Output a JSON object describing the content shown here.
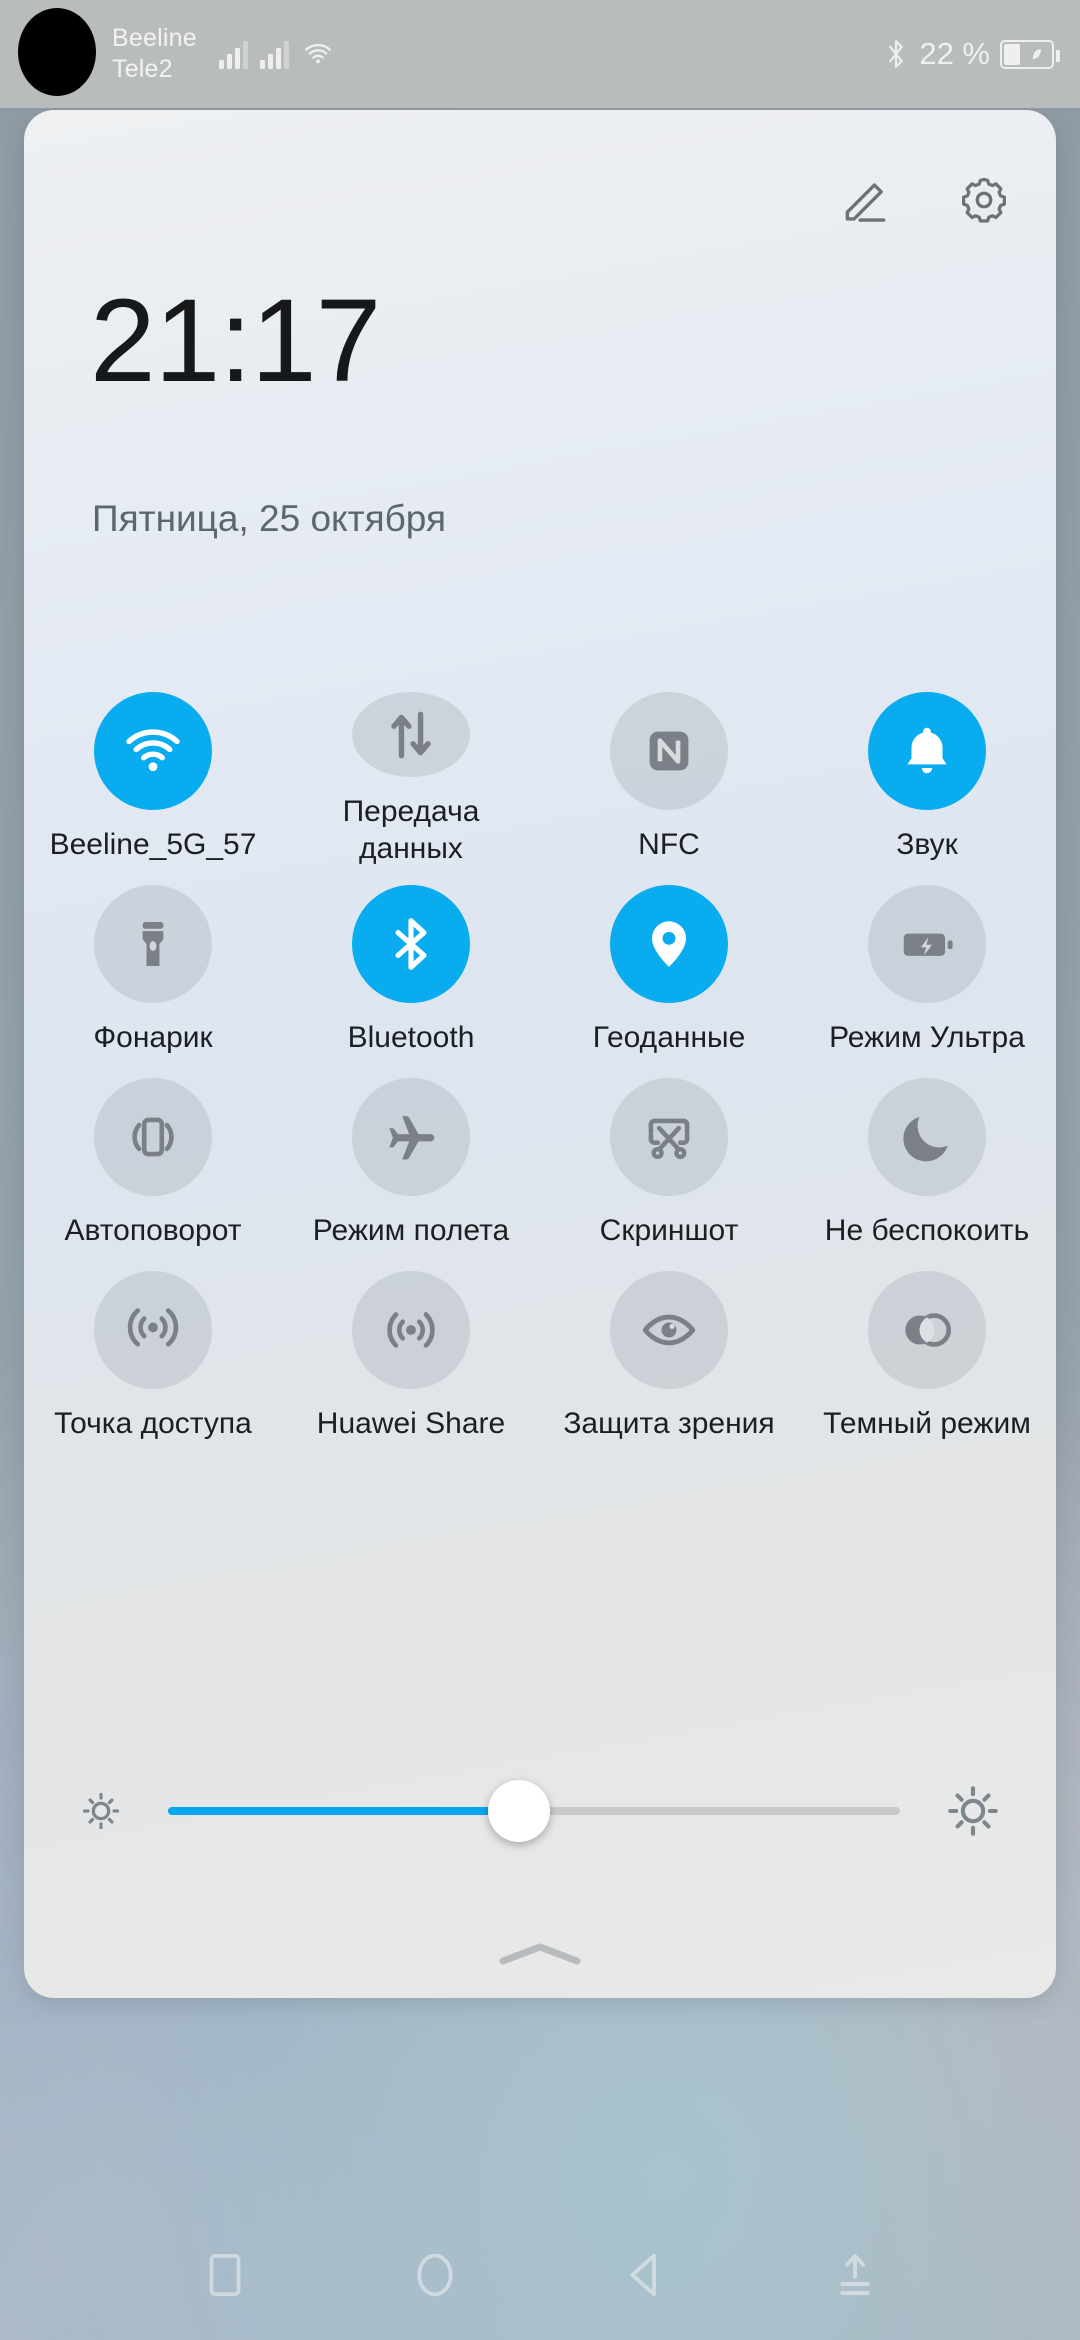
{
  "status_bar": {
    "carriers": [
      "Beeline",
      "Tele2"
    ],
    "icons": [
      "signal-bars-sim1-icon",
      "signal-bars-sim2-icon",
      "wifi-icon",
      "bluetooth-icon"
    ],
    "battery_percent": "22 %",
    "battery_icon": "battery-power-saving-leaf-icon",
    "camera_punch_hole": "front-camera-cutout"
  },
  "panel": {
    "header": {
      "edit_icon": "pencil-edit-icon",
      "settings_icon": "gear-settings-icon"
    },
    "clock": "21:17",
    "date": "Пятница, 25 октября",
    "tiles": [
      {
        "label": "Beeline_5G_57",
        "icon": "wifi-icon",
        "active": true
      },
      {
        "label": "Передача данных",
        "icon": "data-transfer-icon",
        "active": false
      },
      {
        "label": "NFC",
        "icon": "nfc-icon",
        "active": false
      },
      {
        "label": "Звук",
        "icon": "bell-sound-icon",
        "active": true
      },
      {
        "label": "Фонарик",
        "icon": "flashlight-icon",
        "active": false
      },
      {
        "label": "Bluetooth",
        "icon": "bluetooth-icon",
        "active": true
      },
      {
        "label": "Геоданные",
        "icon": "location-pin-icon",
        "active": true
      },
      {
        "label": "Режим Ультра",
        "icon": "battery-bolt-icon",
        "active": false
      },
      {
        "label": "Автоповорот",
        "icon": "auto-rotate-icon",
        "active": false
      },
      {
        "label": "Режим полета",
        "icon": "airplane-icon",
        "active": false
      },
      {
        "label": "Скриншот",
        "icon": "scissors-screenshot-icon",
        "active": false
      },
      {
        "label": "Не беспокоить",
        "icon": "moon-dnd-icon",
        "active": false
      },
      {
        "label": "Точка доступа",
        "icon": "hotspot-icon",
        "active": false
      },
      {
        "label": "Huawei Share",
        "icon": "huawei-share-icon",
        "active": false
      },
      {
        "label": "Защита зрения",
        "icon": "eye-comfort-icon",
        "active": false
      },
      {
        "label": "Темный режим",
        "icon": "dark-mode-circles-icon",
        "active": false
      }
    ],
    "brightness": {
      "low_icon": "sun-small-icon",
      "high_icon": "sun-large-icon",
      "value_percent": 48
    },
    "collapse_handle": "chevron-up-handle-icon"
  },
  "nav_bar": {
    "buttons": [
      {
        "name": "recents-button",
        "icon": "square-recents-icon"
      },
      {
        "name": "home-button",
        "icon": "circle-home-icon"
      },
      {
        "name": "back-button",
        "icon": "triangle-back-icon"
      },
      {
        "name": "hide-navbar-button",
        "icon": "arrow-up-hide-icon"
      }
    ]
  },
  "colors": {
    "accent_active": "#0aacf0",
    "tile_inactive": "#afb5bd",
    "status_bar_bg": "#b9bcbd",
    "clock_text": "#16181a",
    "date_text": "#5c6670"
  }
}
